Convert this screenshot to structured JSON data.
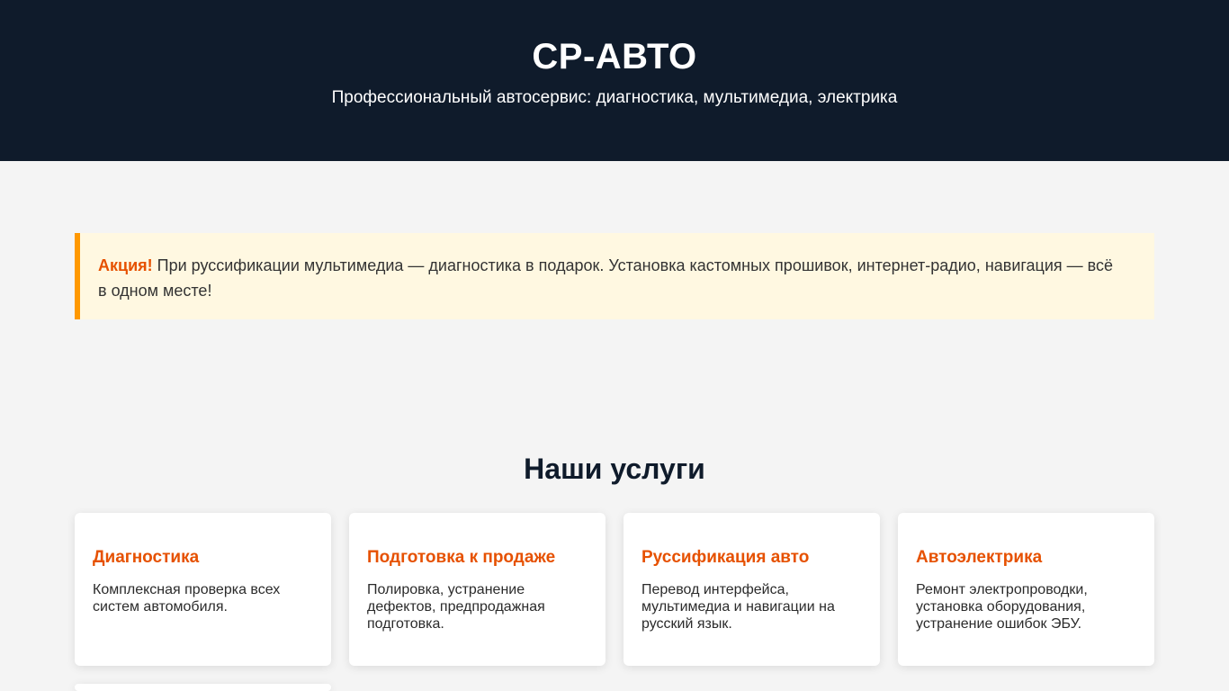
{
  "header": {
    "title": "СР-АВТО",
    "tagline": "Профессиональный автосервис: диагностика, мультимедиа, электрика"
  },
  "promo": {
    "label": "Акция!",
    "text": " При руссификации мультимедиа — диагностика в подарок. Установка кастомных прошивок, интернет-радио, навигация — всё в одном месте!"
  },
  "services": {
    "title": "Наши услуги",
    "items": [
      {
        "title": "Диагностика",
        "text": "Комплексная проверка всех систем автомобиля."
      },
      {
        "title": "Подготовка к продаже",
        "text": "Полировка, устранение дефектов, предпродажная подготовка."
      },
      {
        "title": "Руссификация авто",
        "text": "Перевод интерфейса, мультимедиа и навигации на русский язык."
      },
      {
        "title": "Автоэлектрика",
        "text": "Ремонт электропроводки, установка оборудования, устранение ошибок ЭБУ."
      }
    ]
  },
  "colors": {
    "header_bg": "#0f1b2b",
    "accent": "#e65100",
    "promo_bg": "#fff8e1",
    "promo_border": "#ff9800"
  }
}
